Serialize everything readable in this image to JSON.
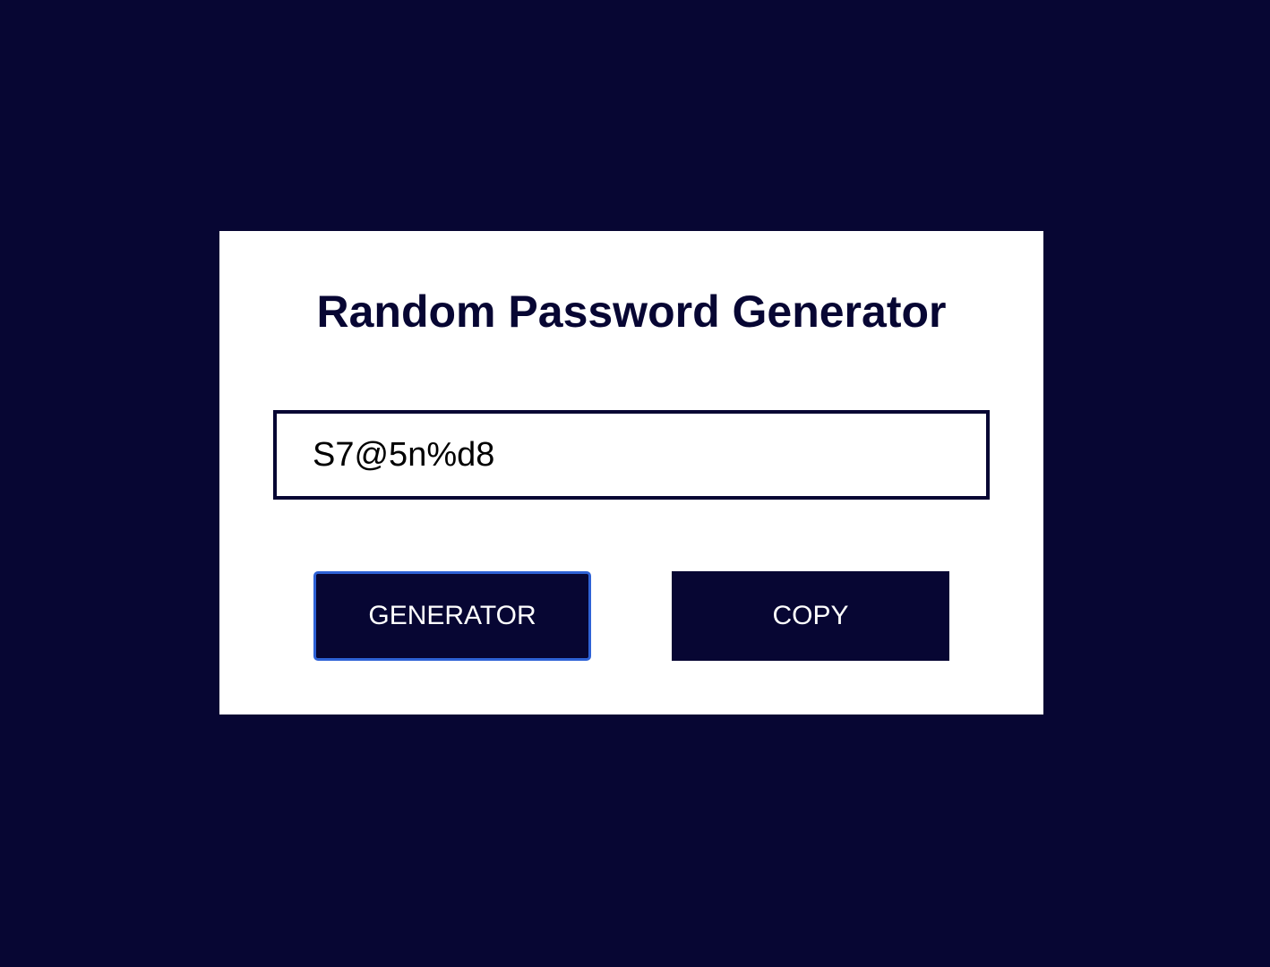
{
  "app": {
    "title": "Random Password Generator"
  },
  "password_field": {
    "value": "S7@5n%d8"
  },
  "buttons": {
    "generator_label": "GENERATOR",
    "copy_label": "COPY"
  },
  "colors": {
    "background": "#070633",
    "card": "#ffffff",
    "button": "#070633",
    "focus_ring": "#2e62d6"
  }
}
